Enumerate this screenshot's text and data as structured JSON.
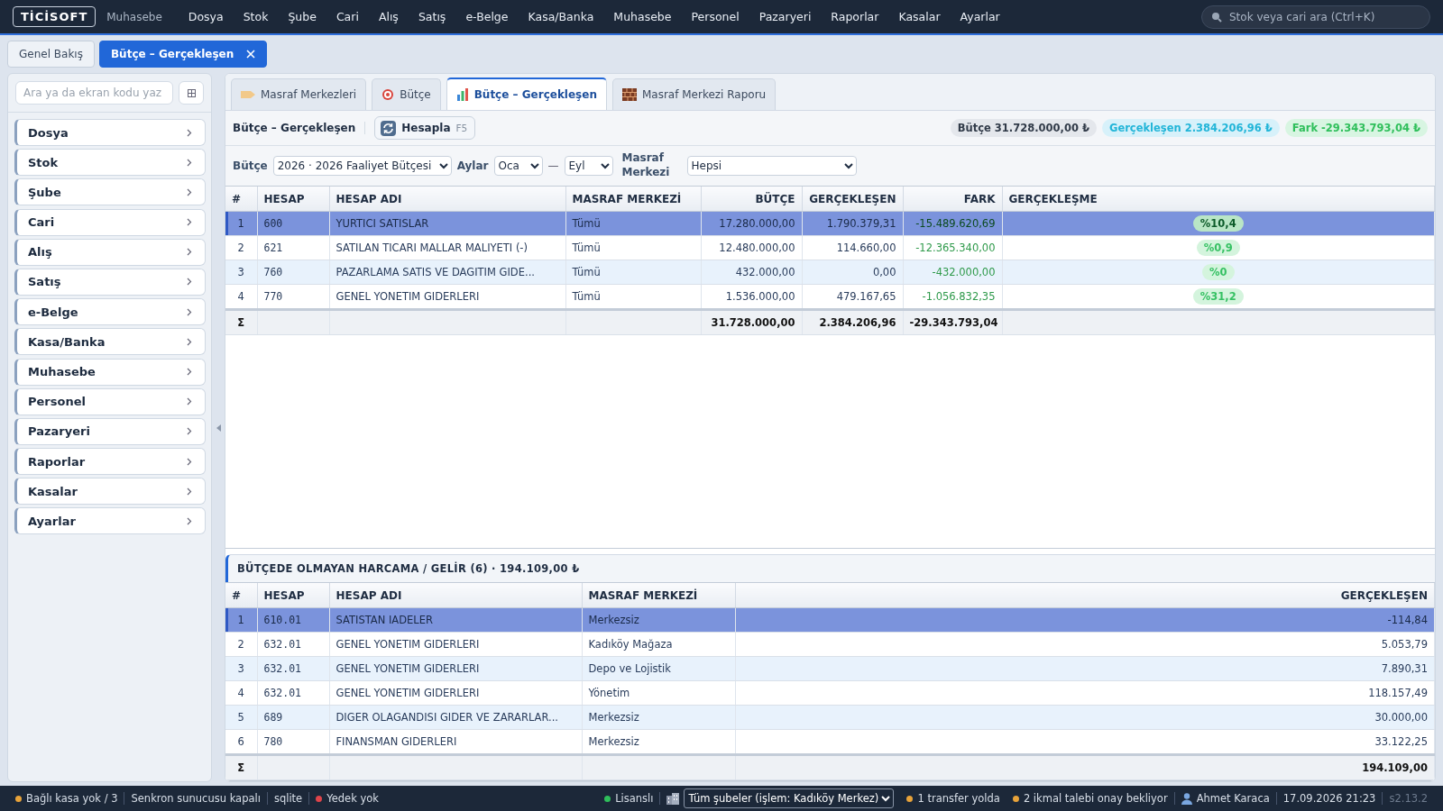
{
  "topbar": {
    "logo": "TİCİSOFT",
    "module": "Muhasebe",
    "menu": [
      "Dosya",
      "Stok",
      "Şube",
      "Cari",
      "Alış",
      "Satış",
      "e-Belge",
      "Kasa/Banka",
      "Muhasebe",
      "Personel",
      "Pazaryeri",
      "Raporlar",
      "Kasalar",
      "Ayarlar"
    ],
    "search": {
      "placeholder": "Stok veya cari ara (Ctrl+K)"
    }
  },
  "doc_tabs": [
    {
      "label": "Genel Bakış",
      "selected": false,
      "closable": false
    },
    {
      "label": "Bütçe – Gerçekleşen",
      "selected": true,
      "closable": true
    }
  ],
  "sidebar": {
    "search": {
      "placeholder": "Ara ya da ekran kodu yaz"
    },
    "items": [
      "Dosya",
      "Stok",
      "Şube",
      "Cari",
      "Alış",
      "Satış",
      "e-Belge",
      "Kasa/Banka",
      "Muhasebe",
      "Personel",
      "Pazaryeri",
      "Raporlar",
      "Kasalar",
      "Ayarlar"
    ]
  },
  "tabs": [
    {
      "label": "Masraf Merkezleri",
      "kind": "tag",
      "selected": false
    },
    {
      "label": "Bütçe",
      "kind": "target",
      "selected": false
    },
    {
      "label": "Bütçe – Gerçekleşen",
      "kind": "chart",
      "selected": true
    },
    {
      "label": "Masraf Merkezi Raporu",
      "kind": "bricks",
      "selected": false
    }
  ],
  "toolbar": {
    "title": "Bütçe – Gerçekleşen",
    "button": {
      "label": "Hesapla",
      "shortcut": "F5"
    },
    "pills": [
      {
        "kind": "budget",
        "text": "Bütçe 31.728.000,00 ₺"
      },
      {
        "kind": "actual",
        "text": "Gerçekleşen 2.384.206,96 ₺"
      },
      {
        "kind": "diff",
        "text": "Fark -29.343.793,04 ₺"
      }
    ]
  },
  "filters": {
    "budget": {
      "label": "Bütçe",
      "value": "2026 · 2026 Faaliyet Bütçesi"
    },
    "months": {
      "label": "Aylar",
      "from": "Oca",
      "separator": "—",
      "to": "Eyl"
    },
    "cost_center": {
      "label": "Masraf Merkezi",
      "value": "Hepsi"
    }
  },
  "table": {
    "columns": [
      "#",
      "HESAP",
      "HESAP ADI",
      "MASRAF MERKEZİ",
      "BÜTÇE",
      "GERÇEKLEŞEN",
      "FARK",
      "GERÇEKLEŞME"
    ],
    "rows": [
      {
        "no": "1",
        "account": "600",
        "name": "YURTICI SATISLAR",
        "center": "Tümü",
        "budget": "17.280.000,00",
        "actual": "1.790.379,31",
        "diff": "-15.489.620,69",
        "ratio": "%10,4",
        "selected": true
      },
      {
        "no": "2",
        "account": "621",
        "name": "SATILAN TICARI MALLAR MALIYETI (-)",
        "center": "Tümü",
        "budget": "12.480.000,00",
        "actual": "114.660,00",
        "diff": "-12.365.340,00",
        "ratio": "%0,9",
        "selected": false
      },
      {
        "no": "3",
        "account": "760",
        "name": "PAZARLAMA SATIS VE DAGITIM GIDE...",
        "center": "Tümü",
        "budget": "432.000,00",
        "actual": "0,00",
        "diff": "-432.000,00",
        "ratio": "%0",
        "selected": false
      },
      {
        "no": "4",
        "account": "770",
        "name": "GENEL YONETIM GIDERLERI",
        "center": "Tümü",
        "budget": "1.536.000,00",
        "actual": "479.167,65",
        "diff": "-1.056.832,35",
        "ratio": "%31,2",
        "selected": false
      }
    ],
    "total": {
      "symbol": "Σ",
      "budget": "31.728.000,00",
      "actual": "2.384.206,96",
      "diff": "-29.343.793,04"
    }
  },
  "extra": {
    "title": "BÜTÇEDE OLMAYAN HARCAMA / GELİR (6) · 194.109,00 ₺",
    "columns": [
      "#",
      "HESAP",
      "HESAP ADI",
      "MASRAF MERKEZİ",
      "GERÇEKLEŞEN"
    ],
    "rows": [
      {
        "no": "1",
        "account": "610.01",
        "name": "SATISTAN IADELER",
        "center": "Merkezsiz",
        "actual": "-114,84",
        "selected": true
      },
      {
        "no": "2",
        "account": "632.01",
        "name": "GENEL YONETIM GIDERLERI",
        "center": "Kadıköy Mağaza",
        "actual": "5.053,79",
        "selected": false
      },
      {
        "no": "3",
        "account": "632.01",
        "name": "GENEL YONETIM GIDERLERI",
        "center": "Depo ve Lojistik",
        "actual": "7.890,31",
        "selected": false
      },
      {
        "no": "4",
        "account": "632.01",
        "name": "GENEL YONETIM GIDERLERI",
        "center": "Yönetim",
        "actual": "118.157,49",
        "selected": false
      },
      {
        "no": "5",
        "account": "689",
        "name": "DIGER OLAGANDISI GIDER VE ZARARLAR...",
        "center": "Merkezsiz",
        "actual": "30.000,00",
        "selected": false
      },
      {
        "no": "6",
        "account": "780",
        "name": "FINANSMAN GIDERLERI",
        "center": "Merkezsiz",
        "actual": "33.122,25",
        "selected": false
      }
    ],
    "total": {
      "symbol": "Σ",
      "actual": "194.109,00"
    }
  },
  "status_bar": {
    "left": [
      {
        "text": "Bağlı kasa yok / 3",
        "color": "#e8a33a"
      },
      {
        "text": "Senkron sunucusu kapalı"
      },
      {
        "text": "sqlite"
      },
      {
        "text": "Yedek yok",
        "color": "#e0444a"
      }
    ],
    "right": [
      {
        "kind": "text",
        "text": "Lisanslı",
        "color": "#2fbf5b"
      },
      {
        "kind": "select",
        "text": "Tüm şubeler (işlem: Kadıköy Merkez)"
      },
      {
        "kind": "text",
        "text": "1 transfer yolda",
        "color": "#e8a33a"
      },
      {
        "kind": "text",
        "text": "2 ikmal talebi onay bekliyor",
        "color": "#e8a33a"
      },
      {
        "kind": "user",
        "text": "Ahmet Karaca"
      },
      {
        "kind": "text",
        "text": "17.09.2026 21:23"
      },
      {
        "kind": "version",
        "text": "s2.13.2"
      }
    ]
  }
}
